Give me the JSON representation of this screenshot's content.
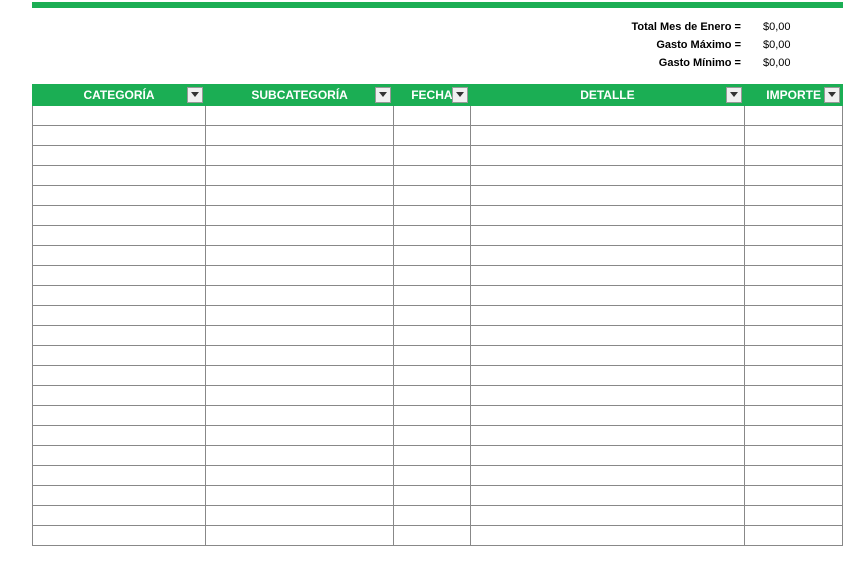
{
  "summary": {
    "rows": [
      {
        "label": "Total Mes de Enero =",
        "value": "$0,00"
      },
      {
        "label": "Gasto Máximo =",
        "value": "$0,00"
      },
      {
        "label": "Gasto Mínimo =",
        "value": "$0,00"
      }
    ]
  },
  "table": {
    "headers": {
      "categoria": "CATEGORÍA",
      "subcategoria": "SUBCATEGORÍA",
      "fecha": "FECHA",
      "detalle": "DETALLE",
      "importe": "IMPORTE"
    },
    "row_count": 22
  },
  "colors": {
    "accent": "#1BAE54"
  }
}
